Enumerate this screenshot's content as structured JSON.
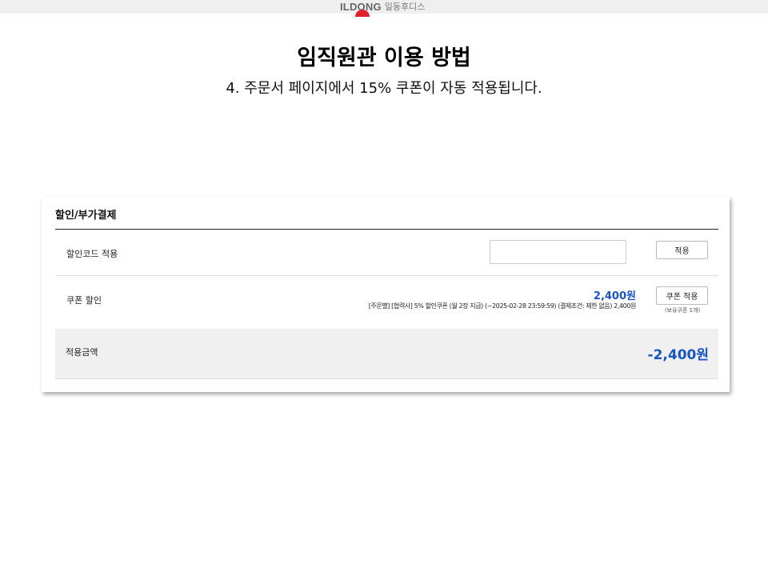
{
  "header": {
    "logo_text": "ILDONG",
    "logo_subtext": "일동후디스"
  },
  "page": {
    "title": "임직원관 이용 방법",
    "subtitle": "4. 주문서 페이지에서 15% 쿠폰이 자동 적용됩니다."
  },
  "discount_panel": {
    "heading": "할인/부가결제",
    "discount_code": {
      "label": "할인코드 적용",
      "input_value": "",
      "apply_button": "적용"
    },
    "coupon": {
      "label": "쿠폰 할인",
      "amount": "2,400원",
      "description": "[주문별] [협력사] 5% 할인쿠폰 (월 2장 지급) (~2025-02-28 23:59:59) (결제조건: 제한 없음) 2,400원",
      "apply_button": "쿠폰 적용",
      "owned_note": "(보유쿠폰 1개)"
    },
    "total": {
      "label": "적용금액",
      "value": "-2,400원"
    }
  },
  "colors": {
    "accent_blue": "#1a55c8",
    "logo_red": "#e0202a",
    "band_gray": "#f0f0f0"
  }
}
